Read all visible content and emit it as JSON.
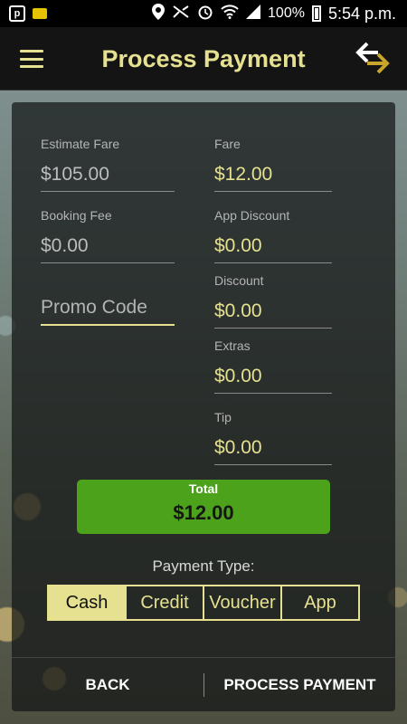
{
  "status_bar": {
    "battery": "100%",
    "time": "5:54 p.m."
  },
  "app_bar": {
    "title": "Process Payment"
  },
  "form": {
    "estimate_fare": {
      "label": "Estimate Fare",
      "value": "$105.00"
    },
    "fare": {
      "label": "Fare",
      "value": "$12.00"
    },
    "booking_fee": {
      "label": "Booking Fee",
      "value": "$0.00"
    },
    "app_discount": {
      "label": "App Discount",
      "value": "$0.00"
    },
    "promo_code": {
      "placeholder": "Promo Code"
    },
    "discount": {
      "label": "Discount",
      "value": "$0.00"
    },
    "extras": {
      "label": "Extras",
      "value": "$0.00"
    },
    "tip": {
      "label": "Tip",
      "value": "$0.00"
    }
  },
  "total": {
    "label": "Total",
    "value": "$12.00"
  },
  "payment_type": {
    "label": "Payment Type:",
    "options": [
      "Cash",
      "Credit",
      "Voucher",
      "App"
    ],
    "selected": "Cash"
  },
  "actions": {
    "back": "BACK",
    "process": "PROCESS PAYMENT"
  },
  "colors": {
    "accent": "#e6e190",
    "total_bg": "#4ca21b"
  }
}
